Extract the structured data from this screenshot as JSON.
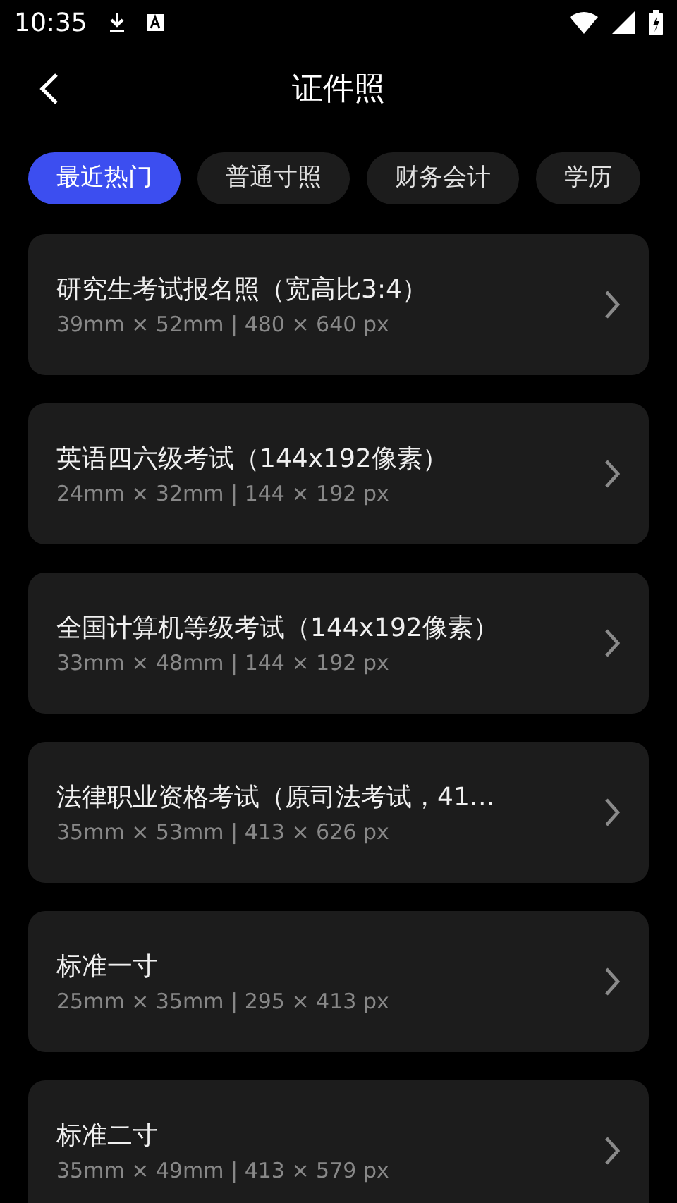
{
  "status_bar": {
    "time": "10:35"
  },
  "header": {
    "title": "证件照"
  },
  "tabs": [
    {
      "label": "最近热门",
      "selected": true
    },
    {
      "label": "普通寸照",
      "selected": false
    },
    {
      "label": "财务会计",
      "selected": false
    },
    {
      "label": "学历",
      "selected": false
    }
  ],
  "items": [
    {
      "title": "研究生考试报名照（宽高比3:4）",
      "size": "39mm × 52mm | 480 × 640 px"
    },
    {
      "title": "英语四六级考试（144x192像素）",
      "size": "24mm × 32mm | 144 × 192 px"
    },
    {
      "title": "全国计算机等级考试（144x192像素）",
      "size": "33mm × 48mm | 144 × 192 px"
    },
    {
      "title": "法律职业资格考试（原司法考试，41…",
      "size": "35mm × 53mm | 413 × 626 px"
    },
    {
      "title": "标准一寸",
      "size": "25mm × 35mm | 295 × 413 px"
    },
    {
      "title": "标准二寸",
      "size": "35mm × 49mm | 413 × 579 px"
    }
  ]
}
